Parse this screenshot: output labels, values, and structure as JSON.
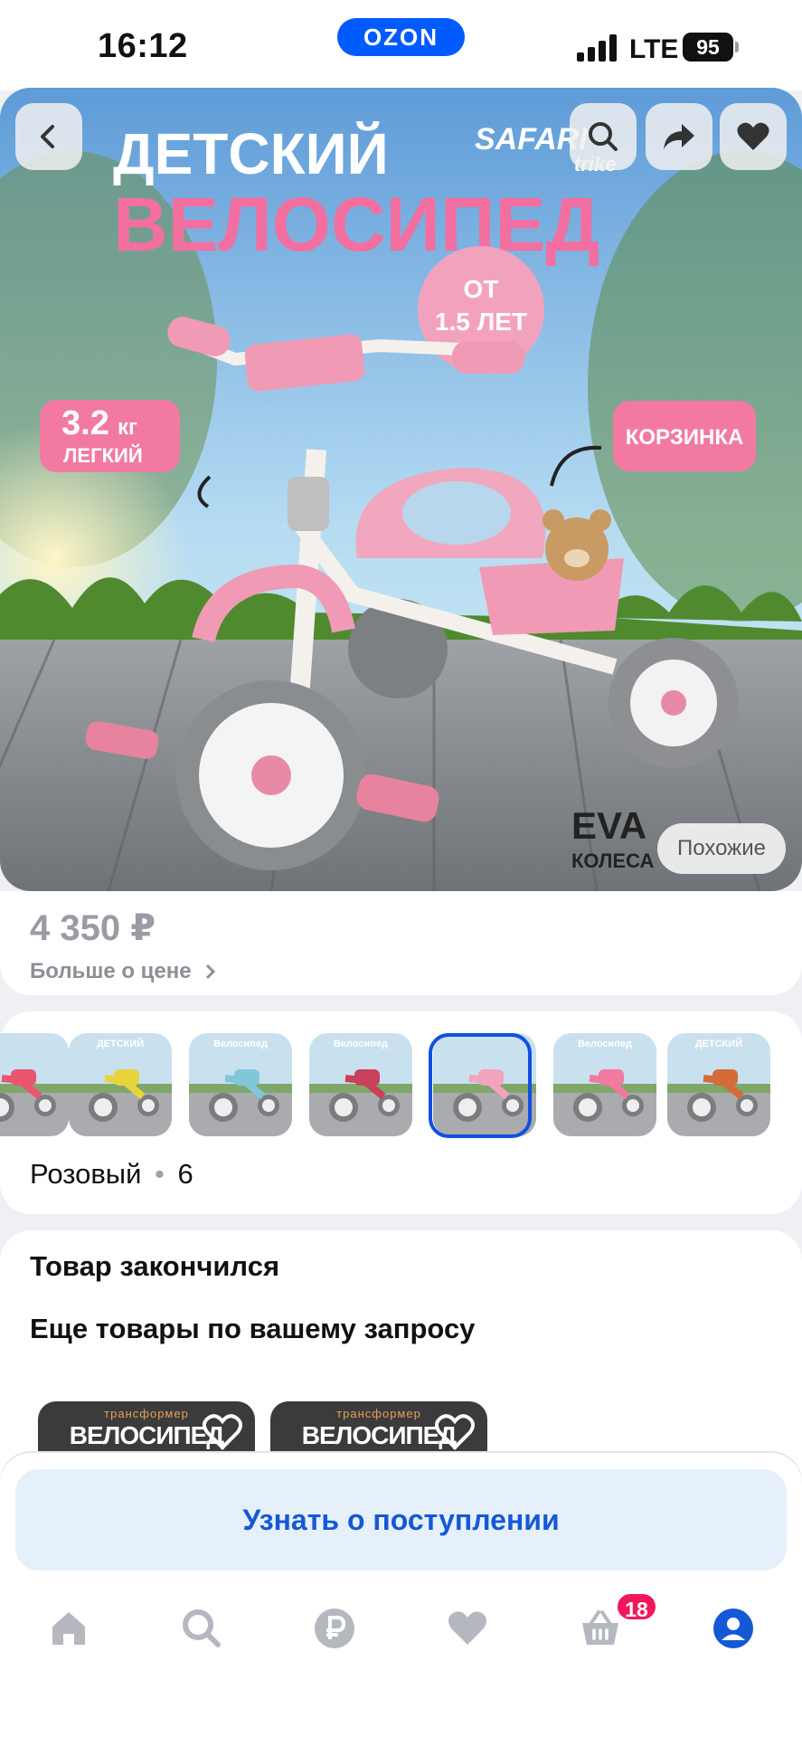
{
  "status_bar": {
    "time": "16:12",
    "app_pill": "OZON",
    "network": "LTE",
    "battery": "95"
  },
  "hero": {
    "headline_1": "ДЕТСКИЙ",
    "headline_2": "ВЕЛОСИПЕД",
    "brand": "SAFARI",
    "brand_sub": "trike",
    "age_badge_1": "ОТ",
    "age_badge_2": "1.5 ЛЕТ",
    "weight_value": "3.2",
    "weight_unit": "кг",
    "weight_label": "ЛЕГКИЙ",
    "basket_label": "КОРЗИНКА",
    "wheels_1": "EVA",
    "wheels_2": "КОЛЕСА",
    "similar_button": "Похожие",
    "icons": [
      "back-icon",
      "search-icon",
      "share-icon",
      "favorite-icon"
    ]
  },
  "price": {
    "value": "4 350 ₽",
    "more": "Больше о цене"
  },
  "variants": {
    "selected_color": "Розовый",
    "separator": "•",
    "count": "6",
    "thumbnails": [
      {
        "title": "",
        "accent": "#e9566e"
      },
      {
        "title": "ДЕТСКИЙ",
        "accent": "#e7d43c"
      },
      {
        "title": "Велосипед",
        "accent": "#7fc7d9"
      },
      {
        "title": "Велосипед",
        "accent": "#c9405a"
      },
      {
        "title": "",
        "accent": "#f2a3bd"
      },
      {
        "title": "Велосипед",
        "accent": "#f07aa0"
      },
      {
        "title": "ДЕТСКИЙ",
        "accent": "#d66b3a"
      }
    ]
  },
  "stock": {
    "out_of_stock": "Товар закончился",
    "more_results": "Еще товары по вашему запросу",
    "recommendations": [
      {
        "subtitle": "трансформер",
        "title": "ВЕЛОСИПЕД"
      },
      {
        "subtitle": "трансформер",
        "title": "ВЕЛОСИПЕД"
      }
    ]
  },
  "actions": {
    "notify_button": "Узнать о поступлении"
  },
  "bottom_nav": {
    "items": [
      "home-icon",
      "search-icon",
      "ruble-icon",
      "favorites-icon",
      "cart-icon",
      "profile-icon"
    ],
    "cart_badge": "18"
  }
}
